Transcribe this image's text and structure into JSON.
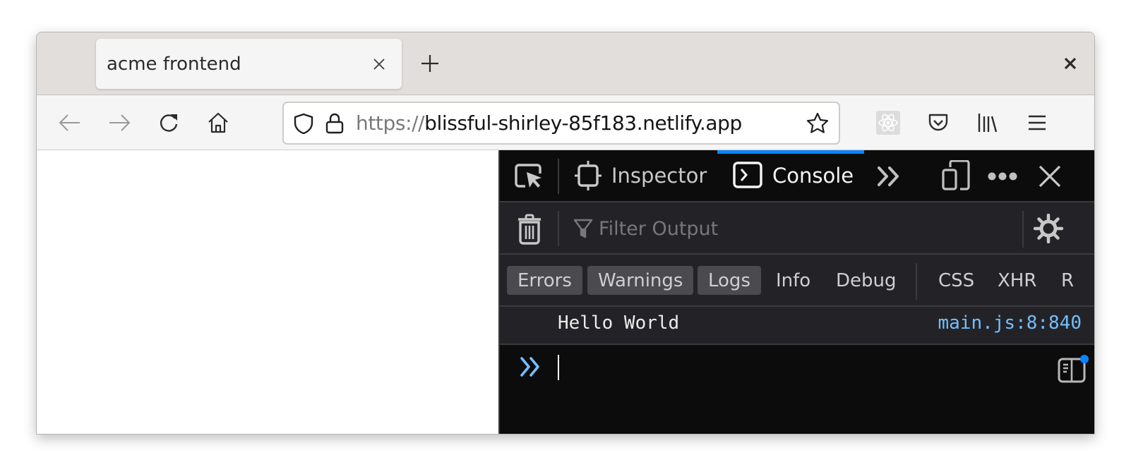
{
  "browser": {
    "tabs": [
      {
        "title": "acme frontend",
        "active": true
      }
    ],
    "tab_close_label": "×",
    "new_tab_label": "+",
    "window_close_label": "✕",
    "nav": {
      "back_icon": "arrow-left-icon",
      "forward_icon": "arrow-right-icon",
      "reload_icon": "reload-icon",
      "home_icon": "home-icon"
    },
    "urlbar": {
      "scheme": "https://",
      "host": "blissful-shirley-85f183.netlify.app",
      "tracking_icon": "shield-icon",
      "lock_icon": "lock-icon",
      "bookmark_icon": "star-icon"
    },
    "toolbar_icons": [
      "react-devtools-icon",
      "pocket-icon",
      "library-icon",
      "menu-icon"
    ]
  },
  "devtools": {
    "tabs": [
      {
        "label": "Inspector",
        "icon": "inspector-icon",
        "active": false
      },
      {
        "label": "Console",
        "icon": "console-icon",
        "active": true
      }
    ],
    "accent_color": "#0a84ff",
    "filter": {
      "placeholder": "Filter Output",
      "value": ""
    },
    "levels": [
      {
        "label": "Errors",
        "enabled": true
      },
      {
        "label": "Warnings",
        "enabled": true
      },
      {
        "label": "Logs",
        "enabled": true
      },
      {
        "label": "Info",
        "enabled": false
      },
      {
        "label": "Debug",
        "enabled": false
      }
    ],
    "request_filters": [
      {
        "label": "CSS",
        "enabled": false
      },
      {
        "label": "XHR",
        "enabled": false
      },
      {
        "label": "R",
        "enabled": false
      }
    ],
    "messages": [
      {
        "text": "Hello World",
        "source": "main.js:8:840"
      }
    ],
    "input": {
      "value": ""
    }
  }
}
